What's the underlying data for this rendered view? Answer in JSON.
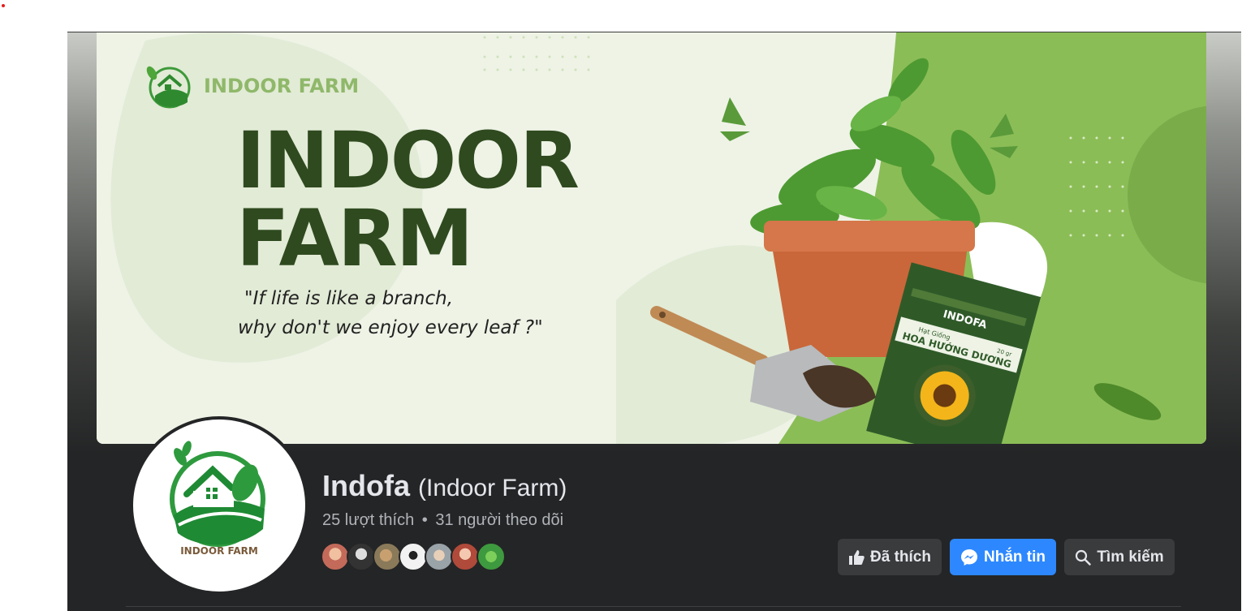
{
  "cover": {
    "brand_name": "INDOOR FARM",
    "headline_line1": "INDOOR",
    "headline_line2": "FARM",
    "quote_line1": "\"If life is like a branch,",
    "quote_line2": "why don't we enjoy every leaf ?\"",
    "packet_brand": "INDOFA",
    "packet_small": "Hạt Giống",
    "packet_title": "HOA HƯỚNG DƯƠNG",
    "packet_weight": "20 gr"
  },
  "profile": {
    "logo_text": "INDOOR FARM",
    "page_name": "Indofa",
    "page_subname": "(Indoor Farm)",
    "likes": "25 lượt thích",
    "separator": "•",
    "followers": "31 người theo dõi",
    "avatar_colors": [
      "#c46a5a",
      "#333333",
      "#8a7a5a",
      "#f2f2f2",
      "#9aa3a8",
      "#b04a3a",
      "#3e9a3e"
    ]
  },
  "actions": {
    "liked_label": "Đã thích",
    "message_label": "Nhắn tin",
    "search_label": "Tìm kiếm"
  },
  "icons": {
    "liked": "thumbs-up-icon",
    "message": "messenger-icon",
    "search": "search-icon"
  },
  "colors": {
    "primary_blue": "#2d88ff",
    "dark_bg": "#242526",
    "button_gray": "#3a3b3c",
    "brand_green": "#2f4a1f"
  }
}
